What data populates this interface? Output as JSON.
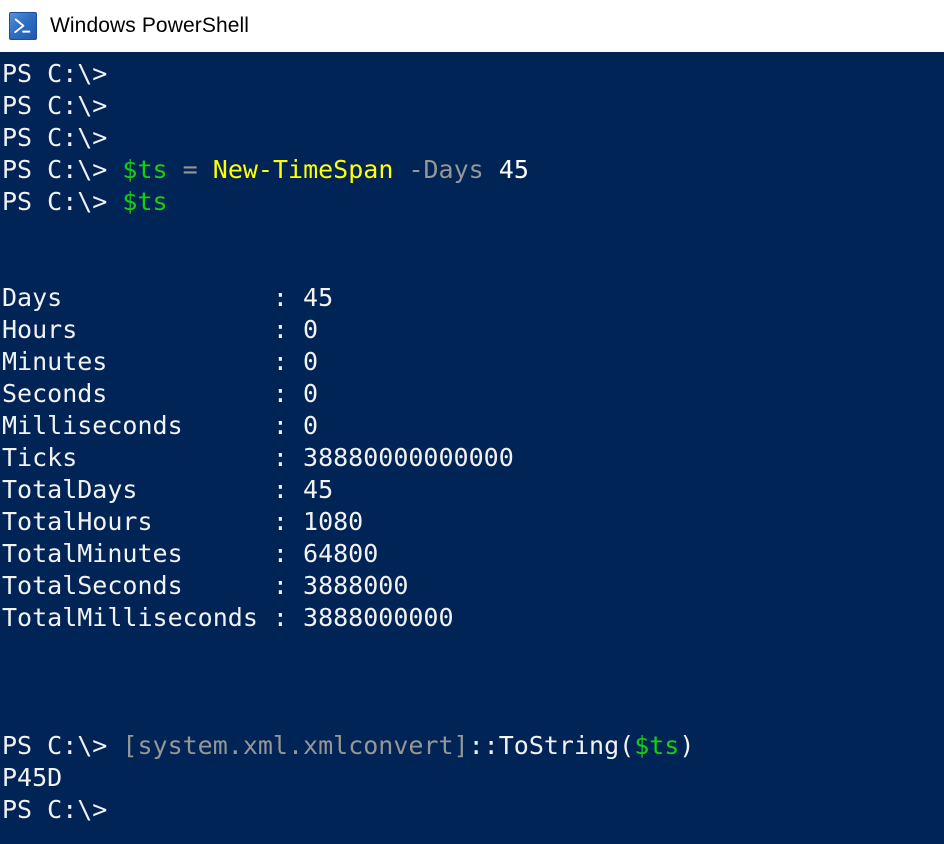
{
  "window": {
    "title": "Windows PowerShell",
    "icon": "powershell-icon",
    "titlebar_bg": "#ffffff",
    "titlebar_fg": "#000000"
  },
  "console": {
    "background": "#012456",
    "foreground": "#f2f2f2",
    "colors": {
      "prompt": "#f2f2f2",
      "variable": "#16d010",
      "command": "#ffff00",
      "operator": "#969696",
      "parameter": "#969696",
      "type_literal": "#969696",
      "output": "#f2f2f2"
    },
    "prompt": "PS C:\\>",
    "lines": [
      {
        "id": "line-1",
        "segments": [
          {
            "text": "PS C:\\>",
            "color": "default"
          }
        ]
      },
      {
        "id": "line-2",
        "segments": [
          {
            "text": "PS C:\\>",
            "color": "default"
          }
        ]
      },
      {
        "id": "line-3",
        "segments": [
          {
            "text": "PS C:\\>",
            "color": "default"
          }
        ]
      },
      {
        "id": "line-4",
        "segments": [
          {
            "text": "PS C:\\> ",
            "color": "default"
          },
          {
            "text": "$ts",
            "color": "green"
          },
          {
            "text": " ",
            "color": "default"
          },
          {
            "text": "=",
            "color": "gray"
          },
          {
            "text": " ",
            "color": "default"
          },
          {
            "text": "New-TimeSpan",
            "color": "yellow"
          },
          {
            "text": " ",
            "color": "default"
          },
          {
            "text": "-Days",
            "color": "gray"
          },
          {
            "text": " ",
            "color": "default"
          },
          {
            "text": "45",
            "color": "white"
          }
        ]
      },
      {
        "id": "line-5",
        "segments": [
          {
            "text": "PS C:\\> ",
            "color": "default"
          },
          {
            "text": "$ts",
            "color": "green"
          }
        ]
      },
      {
        "id": "line-6",
        "segments": [
          {
            "text": "",
            "color": "default"
          }
        ]
      },
      {
        "id": "line-7",
        "segments": [
          {
            "text": "",
            "color": "default"
          }
        ]
      },
      {
        "id": "line-8",
        "segments": [
          {
            "text": "Days              : 45",
            "color": "default"
          }
        ]
      },
      {
        "id": "line-9",
        "segments": [
          {
            "text": "Hours             : 0",
            "color": "default"
          }
        ]
      },
      {
        "id": "line-10",
        "segments": [
          {
            "text": "Minutes           : 0",
            "color": "default"
          }
        ]
      },
      {
        "id": "line-11",
        "segments": [
          {
            "text": "Seconds           : 0",
            "color": "default"
          }
        ]
      },
      {
        "id": "line-12",
        "segments": [
          {
            "text": "Milliseconds      : 0",
            "color": "default"
          }
        ]
      },
      {
        "id": "line-13",
        "segments": [
          {
            "text": "Ticks             : 38880000000000",
            "color": "default"
          }
        ]
      },
      {
        "id": "line-14",
        "segments": [
          {
            "text": "TotalDays         : 45",
            "color": "default"
          }
        ]
      },
      {
        "id": "line-15",
        "segments": [
          {
            "text": "TotalHours        : 1080",
            "color": "default"
          }
        ]
      },
      {
        "id": "line-16",
        "segments": [
          {
            "text": "TotalMinutes      : 64800",
            "color": "default"
          }
        ]
      },
      {
        "id": "line-17",
        "segments": [
          {
            "text": "TotalSeconds      : 3888000",
            "color": "default"
          }
        ]
      },
      {
        "id": "line-18",
        "segments": [
          {
            "text": "TotalMilliseconds : 3888000000",
            "color": "default"
          }
        ]
      },
      {
        "id": "line-19",
        "segments": [
          {
            "text": "",
            "color": "default"
          }
        ]
      },
      {
        "id": "line-20",
        "segments": [
          {
            "text": "",
            "color": "default"
          }
        ]
      },
      {
        "id": "line-21",
        "segments": [
          {
            "text": "",
            "color": "default"
          }
        ]
      },
      {
        "id": "line-22",
        "segments": [
          {
            "text": "PS C:\\> ",
            "color": "default"
          },
          {
            "text": "[system.xml.xmlconvert]",
            "color": "gray"
          },
          {
            "text": "::ToString(",
            "color": "default"
          },
          {
            "text": "$ts",
            "color": "green"
          },
          {
            "text": ")",
            "color": "default"
          }
        ]
      },
      {
        "id": "line-23",
        "segments": [
          {
            "text": "P45D",
            "color": "default"
          }
        ]
      },
      {
        "id": "line-24",
        "segments": [
          {
            "text": "PS C:\\>",
            "color": "default"
          }
        ]
      }
    ],
    "timespan_properties": [
      {
        "name": "Days",
        "value": "45"
      },
      {
        "name": "Hours",
        "value": "0"
      },
      {
        "name": "Minutes",
        "value": "0"
      },
      {
        "name": "Seconds",
        "value": "0"
      },
      {
        "name": "Milliseconds",
        "value": "0"
      },
      {
        "name": "Ticks",
        "value": "38880000000000"
      },
      {
        "name": "TotalDays",
        "value": "45"
      },
      {
        "name": "TotalHours",
        "value": "1080"
      },
      {
        "name": "TotalMinutes",
        "value": "64800"
      },
      {
        "name": "TotalSeconds",
        "value": "3888000"
      },
      {
        "name": "TotalMilliseconds",
        "value": "3888000000"
      }
    ],
    "commands": [
      "$ts = New-TimeSpan -Days 45",
      "$ts",
      "[system.xml.xmlconvert]::ToString($ts)"
    ],
    "outputs": [
      "P45D"
    ]
  }
}
